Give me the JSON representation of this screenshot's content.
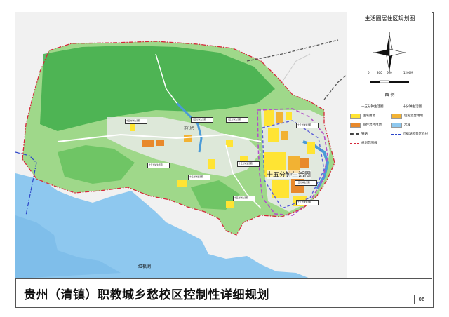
{
  "map": {
    "main_title": "贵州（清镇）职教城乡愁校区控制性详细规划",
    "panel_title": "生活圈居住区规划图",
    "page_number": "06",
    "circle_label": "十五分钟生活圈",
    "lake_label": "红枫湖",
    "lake2_label": "东门河",
    "scale": {
      "ticks": [
        "0",
        "300",
        "600",
        "1200M"
      ]
    },
    "north_arrow": {
      "label": "N"
    },
    "legend": {
      "title": "图 例",
      "items": [
        {
          "label": "十五分钟生活圈",
          "type": "line",
          "color": "#5a5cd8",
          "style": "dash"
        },
        {
          "label": "十分钟生活圈",
          "type": "line",
          "color": "#b24fc9",
          "style": "dash"
        },
        {
          "label": "住宅用地",
          "type": "fill",
          "color": "#ffe433"
        },
        {
          "label": "住宅混合用地",
          "type": "fill",
          "color": "#f2b233"
        },
        {
          "label": "商住混合用地",
          "type": "fill",
          "color": "#e8892b"
        },
        {
          "label": "水域",
          "type": "fill",
          "color": "#8ec8ef"
        },
        {
          "label": "铁路",
          "type": "line",
          "color": "#444444",
          "style": "rail"
        },
        {
          "label": "红枫湖风景区界线",
          "type": "line",
          "color": "#2c45c9",
          "style": "dashdot"
        },
        {
          "label": "规划范围线",
          "type": "line",
          "color": "#d6283a",
          "style": "dashdot"
        }
      ]
    },
    "callouts": [
      {
        "label": "十五分钟生活圈"
      },
      {
        "label": "十五分钟生活圈"
      },
      {
        "label": "十五分钟生活圈"
      },
      {
        "label": "十五分钟生活圈"
      },
      {
        "label": "十五分钟生活圈"
      },
      {
        "label": "十五分钟生活圈"
      },
      {
        "label": "十五分钟生活圈"
      },
      {
        "label": "十五分钟生活圈"
      },
      {
        "label": "十五分钟生活圈"
      },
      {
        "label": "十五分钟生活圈"
      }
    ],
    "colors": {
      "green_dark": "#3fae4a",
      "green_light": "#9fd88a",
      "boundary": "#d6283a",
      "scenic_boundary": "#2c45c9",
      "water": "#8ec8ef",
      "residential": "#ffe433",
      "residential_mixed": "#f2b233",
      "commercial_mixed": "#e8892b"
    }
  }
}
